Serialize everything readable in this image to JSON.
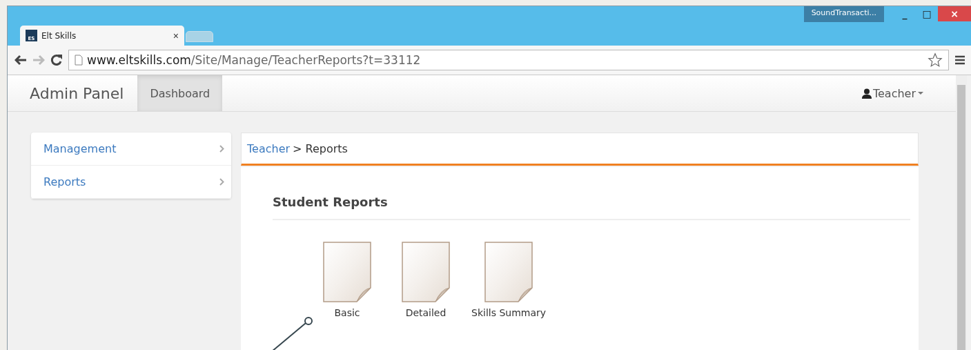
{
  "window": {
    "taskbar_item": "SoundTransacti...",
    "controls": [
      "_",
      "□",
      "×"
    ]
  },
  "tabs": [
    {
      "title": "Elt Skills",
      "logo": "ES",
      "close": "×",
      "selected": true
    },
    {
      "selected": false
    }
  ],
  "address_bar": {
    "host": "www.eltskills.com",
    "path": "/Site/Manage/TeacherReports?t=33112"
  },
  "navbar": {
    "brand": "Admin Panel",
    "items": [
      {
        "label": "Dashboard",
        "selected": true
      }
    ],
    "user": "Teacher"
  },
  "sidebar": {
    "items": [
      {
        "label": "Management"
      },
      {
        "label": "Reports"
      }
    ]
  },
  "breadcrumb": {
    "link": "Teacher",
    "current": "> Reports"
  },
  "section_title": "Student Reports",
  "reports": [
    {
      "label": "Basic"
    },
    {
      "label": "Detailed"
    },
    {
      "label": "Skills Summary"
    }
  ]
}
